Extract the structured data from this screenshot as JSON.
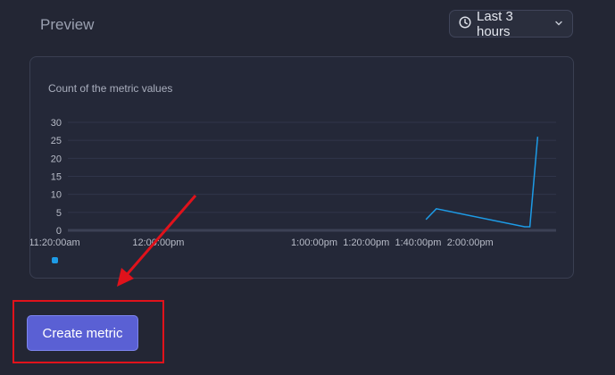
{
  "header": {
    "title": "Preview",
    "time_range": {
      "label": "Last 3 hours",
      "icon": "clock-icon",
      "dropdown_icon": "chevron-down-icon"
    }
  },
  "chart_data": {
    "type": "line",
    "title": "Count of the metric values",
    "xlabel": "",
    "ylabel": "",
    "ylim": [
      0,
      30
    ],
    "yticks": [
      0,
      5,
      10,
      15,
      20,
      25,
      30
    ],
    "xlim": [
      "11:20",
      "2:30"
    ],
    "xticks": [
      {
        "t": "11:20",
        "label": "11:20:00am"
      },
      {
        "t": "12:00",
        "label": "12:00:00pm"
      },
      {
        "t": "1:00",
        "label": "1:00:00pm"
      },
      {
        "t": "1:20",
        "label": "1:20:00pm"
      },
      {
        "t": "1:40",
        "label": "1:40:00pm"
      },
      {
        "t": "2:00",
        "label": "2:00:00pm"
      }
    ],
    "grid": true,
    "legend": "bottom-left",
    "color": "#1d9be6",
    "series": [
      {
        "x": [
          "1:43",
          "1:47",
          "2:21",
          "2:23",
          "2:26"
        ],
        "y": [
          3,
          6,
          1,
          1,
          26
        ]
      }
    ]
  },
  "annotation": {
    "color": "#e0121b"
  },
  "actions": {
    "create_label": "Create metric",
    "accent": "#5a60d4"
  }
}
